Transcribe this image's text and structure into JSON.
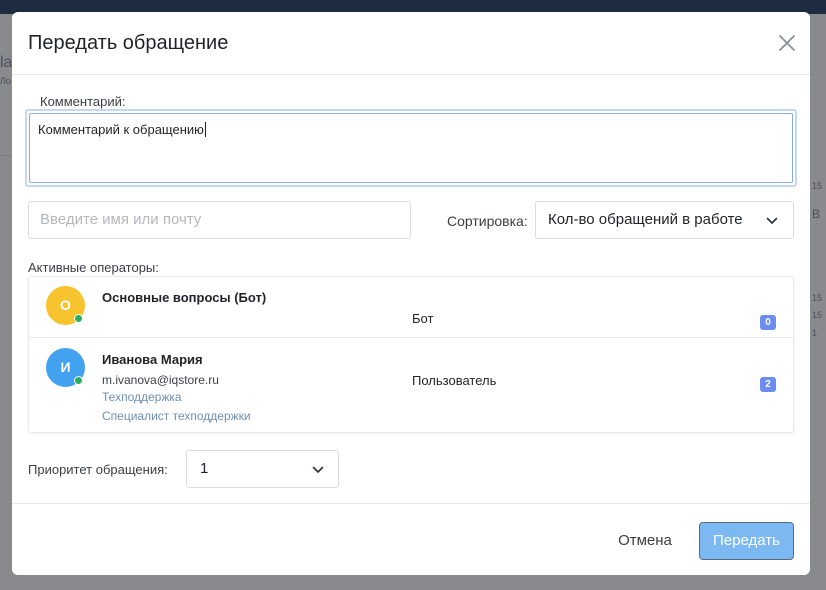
{
  "modal": {
    "title": "Передать обращение",
    "close_icon": "close-icon"
  },
  "comment": {
    "label": "Комментарий:",
    "value": "Комментарий к обращению"
  },
  "search": {
    "placeholder": "Введите имя или почту"
  },
  "sort": {
    "label": "Сортировка:",
    "selected": "Кол-во обращений в работе",
    "icon": "chevron-down-icon"
  },
  "operators": {
    "label": "Активные операторы:",
    "items": [
      {
        "initial": "О",
        "name": "Основные вопросы (Бот)",
        "role": "Бот",
        "count": "0",
        "avatar_color": "#f7c32e",
        "status": "online"
      },
      {
        "initial": "И",
        "name": "Иванова Мария",
        "email": "m.ivanova@iqstore.ru",
        "department": "Техподдержка",
        "position": "Специалист техподдержки",
        "role": "Пользователь",
        "count": "2",
        "avatar_color": "#42a2ef",
        "status": "online"
      }
    ]
  },
  "priority": {
    "label": "Приоритет обращения:",
    "selected": "1",
    "icon": "chevron-down-icon"
  },
  "footer": {
    "cancel_label": "Отмена",
    "submit_label": "Передать"
  },
  "background": {
    "fragments": [
      "la",
      "Ло",
      "15",
      "В",
      "15",
      "15",
      "1"
    ]
  },
  "colors": {
    "accent": "#7cb9f3",
    "badge": "#6c8cf0",
    "status_online": "#27ae60",
    "backdrop_header": "#1d2c40"
  }
}
